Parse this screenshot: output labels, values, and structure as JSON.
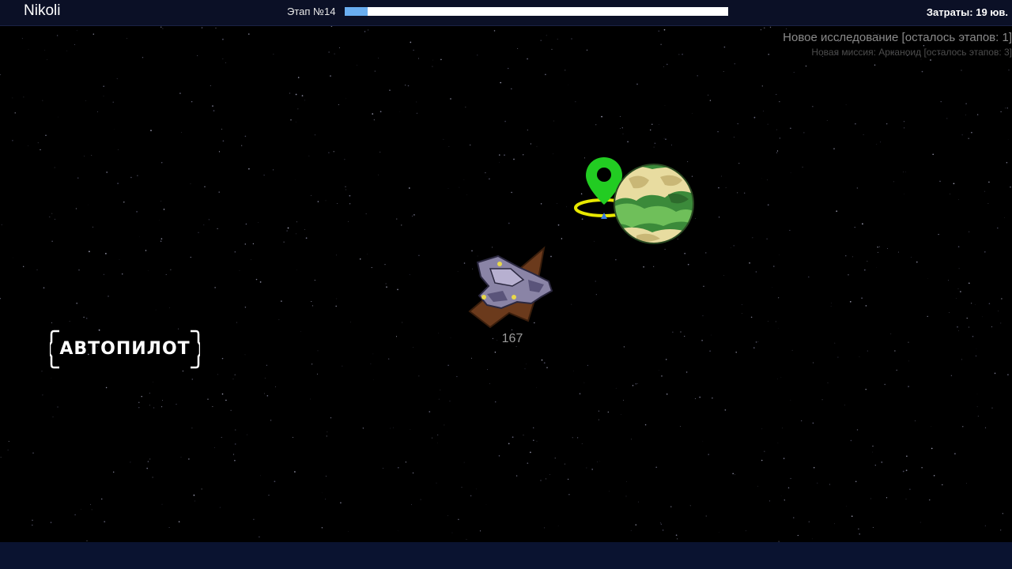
{
  "header": {
    "player_name": "Nikoli",
    "stage_label": "Этап №14",
    "stage_progress_fraction": 0.06,
    "cost_label": "Затраты: 19 юв."
  },
  "missions": {
    "primary": "Новое исследование [осталось этапов: 1]",
    "secondary": "Новая миссия: Арканоид [осталось этапов: 3]"
  },
  "controls": {
    "autopilot_label": "АВТОПИЛОТ"
  },
  "ship": {
    "distance_label": "167"
  },
  "colors": {
    "topbar": "#0b1026",
    "progress_fill": "#6aaef0",
    "marker_green": "#22cc22",
    "marker_ring": "#e8e800",
    "planet_green": "#3b8a3a"
  },
  "icons": {
    "marker": "location-pin-icon",
    "ship": "spaceship-icon",
    "planet": "planet-icon"
  }
}
